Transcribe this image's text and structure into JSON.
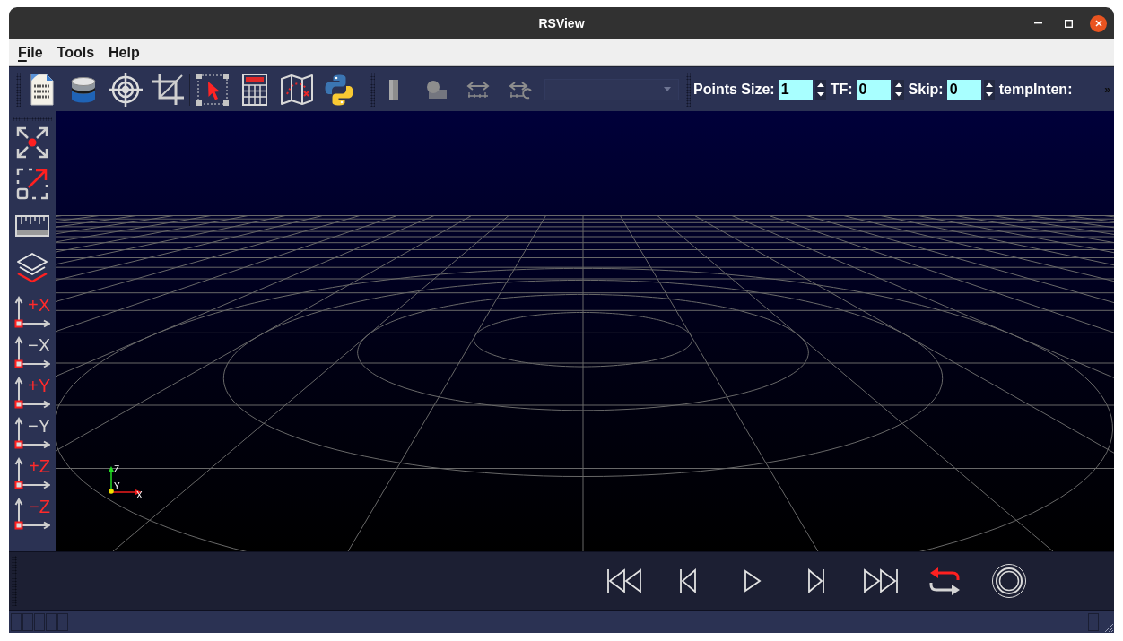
{
  "window": {
    "title": "RSView"
  },
  "menu": [
    {
      "label": "File",
      "mnemonic_shown": true
    },
    {
      "label": "Tools",
      "mnemonic_shown": false
    },
    {
      "label": "Help",
      "mnemonic_shown": false
    }
  ],
  "toolbar": {
    "render_tools": {
      "disabled": true
    },
    "dropdown": {
      "disabled": true
    },
    "spin_boxes": [
      {
        "label": "Points Size:",
        "value": "1"
      },
      {
        "label": "TF:",
        "value": "0"
      },
      {
        "label": "Skip:",
        "value": "0"
      }
    ],
    "trailing_label": "tempInten:",
    "overflow_button": "»"
  },
  "view_buttons": [
    {
      "label": "+X",
      "color": "#ff2a2a"
    },
    {
      "label": "−X",
      "color": "#d4d4d4"
    },
    {
      "label": "+Y",
      "color": "#ff2a2a"
    },
    {
      "label": "−Y",
      "color": "#d4d4d4"
    },
    {
      "label": "+Z",
      "color": "#ff2a2a"
    },
    {
      "label": "−Z",
      "color": "#ff2a2a"
    }
  ],
  "viewport": {
    "axis_labels": [
      "Z",
      "Y",
      "X"
    ]
  }
}
